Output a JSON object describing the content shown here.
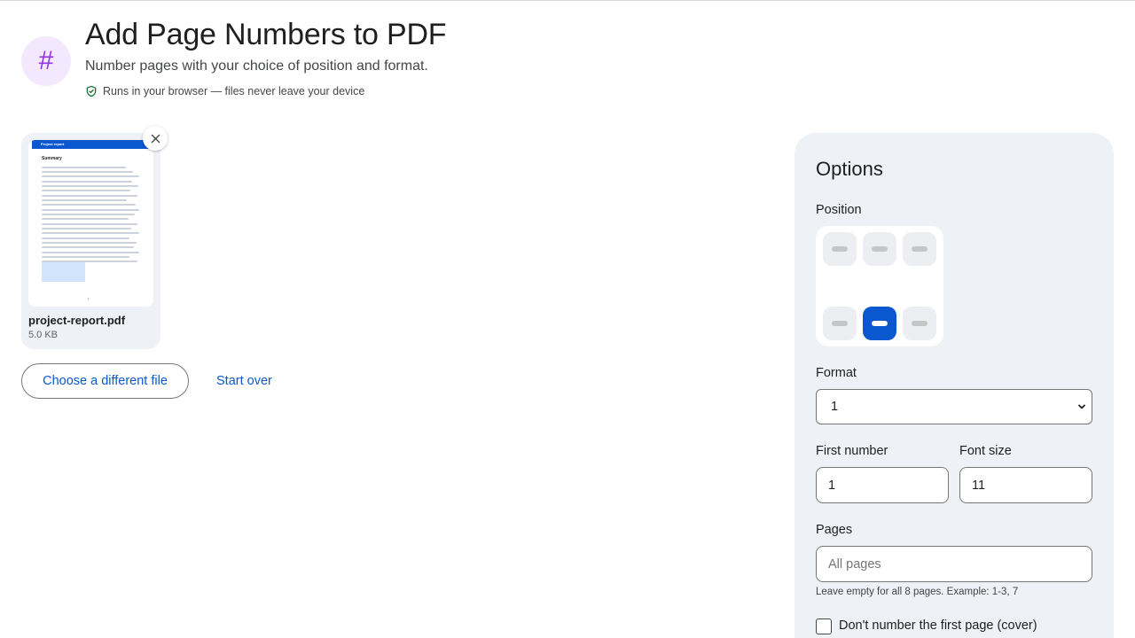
{
  "header": {
    "icon_glyph": "#",
    "title": "Add Page Numbers to PDF",
    "subtitle": "Number pages with your choice of position and format.",
    "privacy_note": "Runs in your browser — files never leave your device"
  },
  "file": {
    "name": "project-report.pdf",
    "size": "5.0 KB",
    "thumbnail": {
      "header_text": "Project report",
      "heading": "Summary",
      "page_number": "1"
    }
  },
  "actions": {
    "choose_label": "Choose a different file",
    "start_over_label": "Start over"
  },
  "options": {
    "title": "Options",
    "position_label": "Position",
    "position_selected": "bottom-center",
    "format_label": "Format",
    "format_value": "1",
    "first_number_label": "First number",
    "first_number_value": "1",
    "font_size_label": "Font size",
    "font_size_value": "11",
    "pages_label": "Pages",
    "pages_placeholder": "All pages",
    "pages_hint": "Leave empty for all 8 pages. Example: 1-3, 7",
    "skip_first_label": "Don't number the first page (cover)",
    "skip_first_checked": false
  },
  "colors": {
    "accent": "#0b57d0",
    "icon_bg": "#f3e8fd",
    "icon_fg": "#9334e6",
    "panel_bg": "#eef1f6"
  }
}
